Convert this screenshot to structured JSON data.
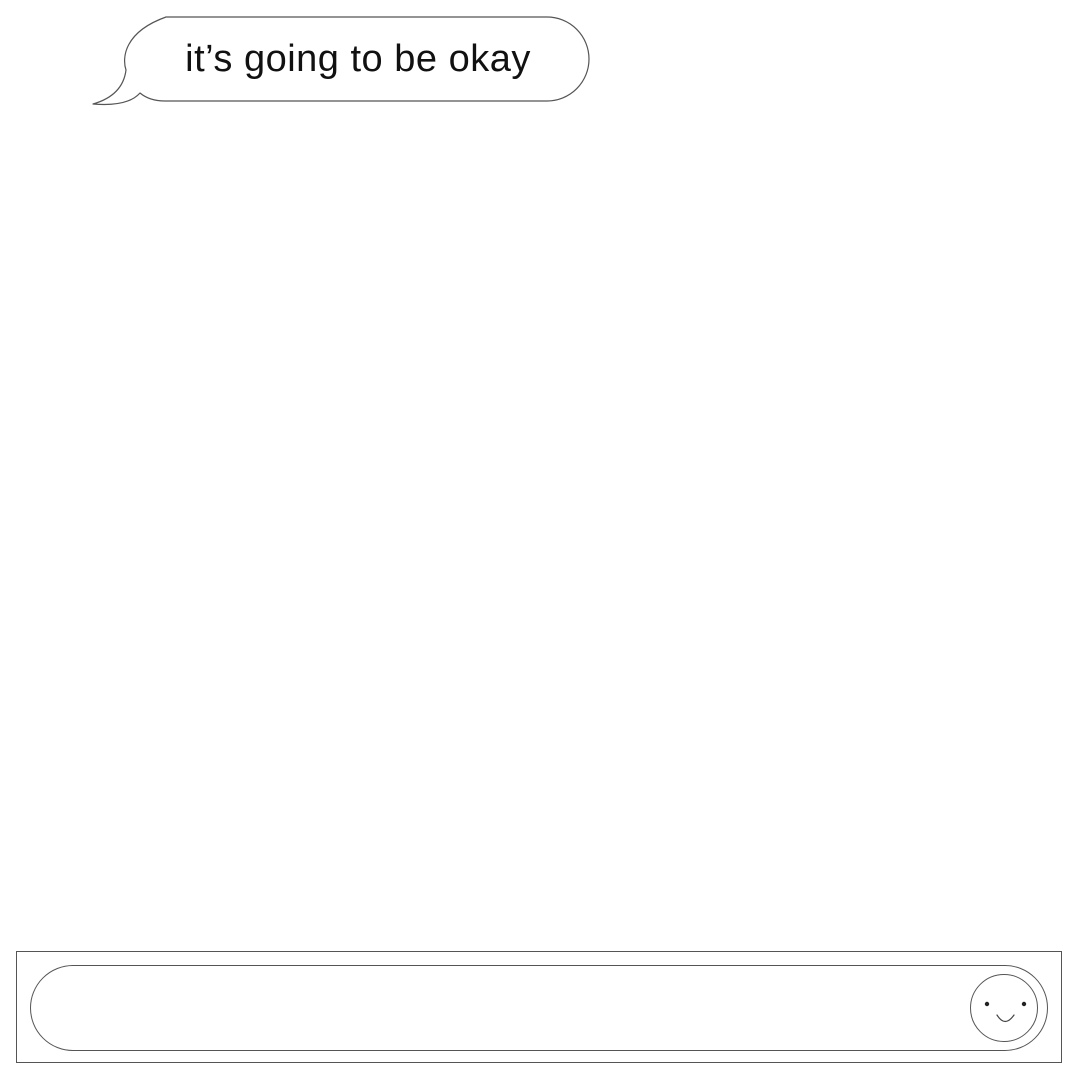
{
  "conversation": {
    "messages": [
      {
        "text": "it’s going to be okay",
        "direction": "incoming"
      }
    ]
  },
  "composer": {
    "value": "",
    "placeholder": "",
    "emoji_icon": "smiley-face-icon"
  },
  "colors": {
    "background": "#ffffff",
    "stroke": "#555555",
    "text": "#111111"
  }
}
